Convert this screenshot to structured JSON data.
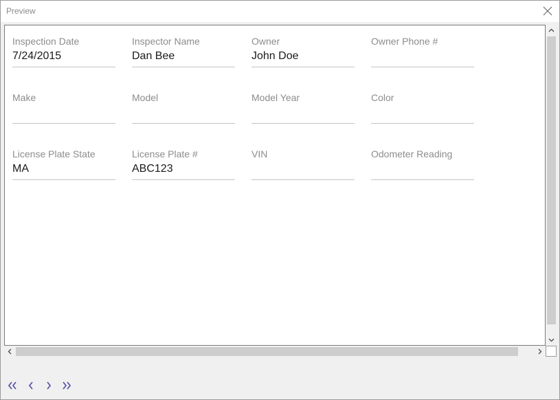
{
  "window": {
    "title": "Preview"
  },
  "form": {
    "fields": [
      {
        "label": "Inspection Date",
        "value": "7/24/2015"
      },
      {
        "label": "Inspector Name",
        "value": "Dan Bee"
      },
      {
        "label": "Owner",
        "value": "John Doe"
      },
      {
        "label": "Owner Phone #",
        "value": ""
      },
      {
        "label": "Make",
        "value": ""
      },
      {
        "label": "Model",
        "value": ""
      },
      {
        "label": "Model Year",
        "value": ""
      },
      {
        "label": "Color",
        "value": ""
      },
      {
        "label": "License Plate State",
        "value": "MA"
      },
      {
        "label": "License Plate #",
        "value": "ABC123"
      },
      {
        "label": "VIN",
        "value": ""
      },
      {
        "label": "Odometer Reading",
        "value": ""
      }
    ]
  },
  "icons": {
    "close": "close-icon",
    "first": "double-chevron-left-icon",
    "prev": "chevron-left-icon",
    "next": "chevron-right-icon",
    "last": "double-chevron-right-icon"
  },
  "colors": {
    "nav_accent": "#5b57a8",
    "label": "#8c8c8c",
    "value": "#1a1a1a"
  }
}
